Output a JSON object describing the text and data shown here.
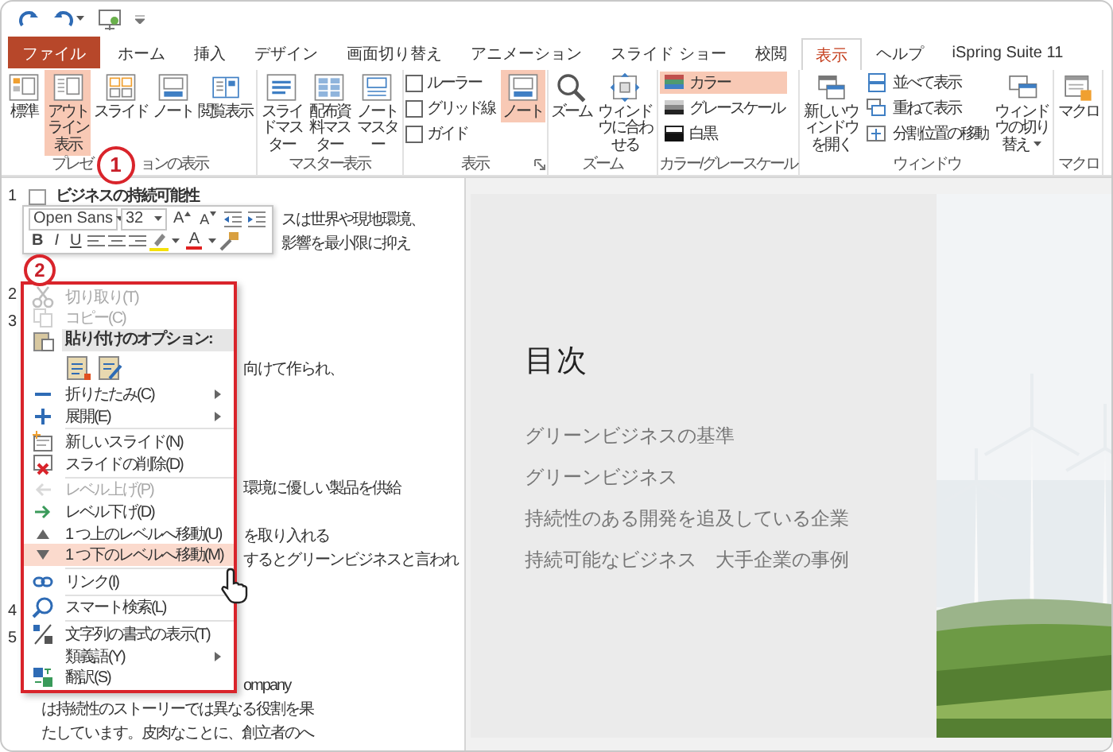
{
  "tabs": [
    {
      "label": "ファイル",
      "kind": "file",
      "selected": false
    },
    {
      "label": "ホーム",
      "kind": "tab",
      "selected": false
    },
    {
      "label": "挿入",
      "kind": "tab",
      "selected": false
    },
    {
      "label": "デザイン",
      "kind": "tab",
      "selected": false
    },
    {
      "label": "画面切り替え",
      "kind": "tab",
      "selected": false
    },
    {
      "label": "アニメーション",
      "kind": "tab",
      "selected": false
    },
    {
      "label": "スライド ショー",
      "kind": "tab",
      "selected": false
    },
    {
      "label": "校閲",
      "kind": "tab",
      "selected": false
    },
    {
      "label": "表示",
      "kind": "tab",
      "selected": true
    },
    {
      "label": "ヘルプ",
      "kind": "tab",
      "selected": false
    },
    {
      "label": "iSpring Suite 11",
      "kind": "tab",
      "selected": false
    }
  ],
  "ribbon": {
    "groups": [
      {
        "label": [
          "プレゼ",
          "ョンの表示"
        ],
        "launcher": false,
        "controls": [
          {
            "kind": "large",
            "label": "標準",
            "selected": false
          },
          {
            "kind": "large",
            "label": "アウトライン表示",
            "selected": true
          },
          {
            "kind": "large",
            "label": "スライド",
            "selected": false
          },
          {
            "kind": "large",
            "label": "ノート",
            "selected": false
          },
          {
            "kind": "large",
            "label": "閲覧表示",
            "selected": false
          }
        ]
      },
      {
        "label": [
          "マスター表示"
        ],
        "launcher": false,
        "controls": [
          {
            "kind": "large",
            "label": "スライドマスター",
            "selected": false
          },
          {
            "kind": "large",
            "label": "配布資料マスター",
            "selected": false
          },
          {
            "kind": "large",
            "label": "ノートマスター",
            "selected": false
          }
        ]
      },
      {
        "label": [
          "表示"
        ],
        "launcher": true,
        "controls": [
          {
            "kind": "check",
            "label": "ルーラー",
            "checked": false
          },
          {
            "kind": "check",
            "label": "グリッド線",
            "checked": false
          },
          {
            "kind": "check",
            "label": "ガイド",
            "checked": false
          },
          {
            "kind": "large",
            "label": "ノート",
            "selected": true
          }
        ]
      },
      {
        "label": [
          "ズーム"
        ],
        "launcher": false,
        "controls": [
          {
            "kind": "large",
            "label": "ズーム",
            "selected": false
          },
          {
            "kind": "large",
            "label": "ウィンドウに合わせる",
            "selected": false
          }
        ]
      },
      {
        "label": [
          "カラー/グレースケール"
        ],
        "launcher": false,
        "controls": [
          {
            "kind": "small",
            "label": "カラー",
            "selected": true
          },
          {
            "kind": "small",
            "label": "グレースケール",
            "selected": false
          },
          {
            "kind": "small",
            "label": "白黒",
            "selected": false
          }
        ]
      },
      {
        "label": [
          "ウィンドウ"
        ],
        "launcher": false,
        "controls": [
          {
            "kind": "large",
            "label": "新しいウィンドウを開く",
            "selected": false
          },
          {
            "kind": "small",
            "label": "並べて表示",
            "selected": false
          },
          {
            "kind": "small",
            "label": "重ねて表示",
            "selected": false
          },
          {
            "kind": "small",
            "label": "分割位置の移動",
            "selected": false
          },
          {
            "kind": "dropdown",
            "label": "ウィンドウの切り替え",
            "selected": false
          }
        ]
      },
      {
        "label": [
          "マクロ"
        ],
        "launcher": false,
        "controls": [
          {
            "kind": "large",
            "label": "マクロ",
            "selected": false
          }
        ]
      }
    ]
  },
  "outline": {
    "rows": [
      {
        "kind": "slide",
        "number": "1",
        "title": "ビジネスの持続可能性"
      },
      {
        "kind": "tail2",
        "text": "スは世界や現地環境、"
      },
      {
        "kind": "tail2",
        "text": "影響を最小限に抑え"
      },
      {
        "kind": "covered"
      },
      {
        "kind": "slide",
        "number": "2"
      },
      {
        "kind": "slide",
        "number": "3"
      },
      {
        "kind": "covered"
      },
      {
        "kind": "tail",
        "text": "向けて作られ、"
      },
      {
        "kind": "covered"
      },
      {
        "kind": "covered"
      },
      {
        "kind": "covered"
      },
      {
        "kind": "covered"
      },
      {
        "kind": "tail",
        "text": "環境に優しい製品を供給"
      },
      {
        "kind": "covered"
      },
      {
        "kind": "tail",
        "text": "を取り入れる"
      },
      {
        "kind": "tail",
        "text": "するとグリーンビジネスと言われ"
      },
      {
        "kind": "covered"
      },
      {
        "kind": "slide",
        "number": "4"
      },
      {
        "kind": "slide",
        "number": "5"
      },
      {
        "kind": "covered"
      },
      {
        "kind": "tail",
        "text": "ompany"
      },
      {
        "kind": "line",
        "text": "は持続性のストーリーでは異なる役割を果"
      },
      {
        "kind": "line",
        "text": "たしています。皮肉なことに、創立者のへ"
      }
    ]
  },
  "mini_toolbar": {
    "font": "Open Sans",
    "size": "32",
    "grow_label": "A",
    "shrink_label": "A",
    "bold": "B",
    "italic": "I",
    "underline": "U",
    "font_color_label": "A"
  },
  "context_menu": {
    "items": [
      {
        "kind": "item",
        "label": "切り取り(T)",
        "disabled": true,
        "submenu": false,
        "selected": false
      },
      {
        "kind": "item",
        "label": "コピー(C)",
        "disabled": true,
        "submenu": false,
        "selected": false
      },
      {
        "kind": "header",
        "label": "貼り付けのオプション:"
      },
      {
        "kind": "paste"
      },
      {
        "kind": "item",
        "label": "折りたたみ(C)",
        "disabled": false,
        "submenu": true,
        "selected": false
      },
      {
        "kind": "item",
        "label": "展開(E)",
        "disabled": false,
        "submenu": true,
        "selected": false
      },
      {
        "kind": "separator"
      },
      {
        "kind": "item",
        "label": "新しいスライド(N)",
        "disabled": false,
        "submenu": false,
        "selected": false
      },
      {
        "kind": "item",
        "label": "スライドの削除(D)",
        "disabled": false,
        "submenu": false,
        "selected": false
      },
      {
        "kind": "separator"
      },
      {
        "kind": "item",
        "label": "レベル上げ(P)",
        "disabled": true,
        "submenu": false,
        "selected": false
      },
      {
        "kind": "item",
        "label": "レベル下げ(D)",
        "disabled": false,
        "submenu": false,
        "selected": false
      },
      {
        "kind": "item",
        "label": "1 つ上のレベルへ移動(U)",
        "disabled": false,
        "submenu": false,
        "selected": false
      },
      {
        "kind": "item",
        "label": "1 つ下のレベルへ移動(M)",
        "disabled": false,
        "submenu": false,
        "selected": true
      },
      {
        "kind": "separator"
      },
      {
        "kind": "item",
        "label": "リンク(I)",
        "disabled": false,
        "submenu": false,
        "selected": false
      },
      {
        "kind": "separator"
      },
      {
        "kind": "item",
        "label": "スマート検索(L)",
        "disabled": false,
        "submenu": false,
        "selected": false
      },
      {
        "kind": "separator"
      },
      {
        "kind": "item",
        "label": "文字列の書式の表示(T)",
        "disabled": false,
        "submenu": false,
        "selected": false
      },
      {
        "kind": "item",
        "label": "類義語(Y)",
        "disabled": false,
        "submenu": true,
        "selected": false
      },
      {
        "kind": "item",
        "label": "翻訳(S)",
        "disabled": false,
        "submenu": false,
        "selected": false
      }
    ]
  },
  "slide": {
    "title": "目次",
    "bullets": [
      "グリーンビジネスの基準",
      "グリーンビジネス",
      "持続性のある開発を追及している企業",
      "持続可能なビジネス　大手企業の事例"
    ]
  },
  "callouts": [
    "1",
    "2"
  ]
}
